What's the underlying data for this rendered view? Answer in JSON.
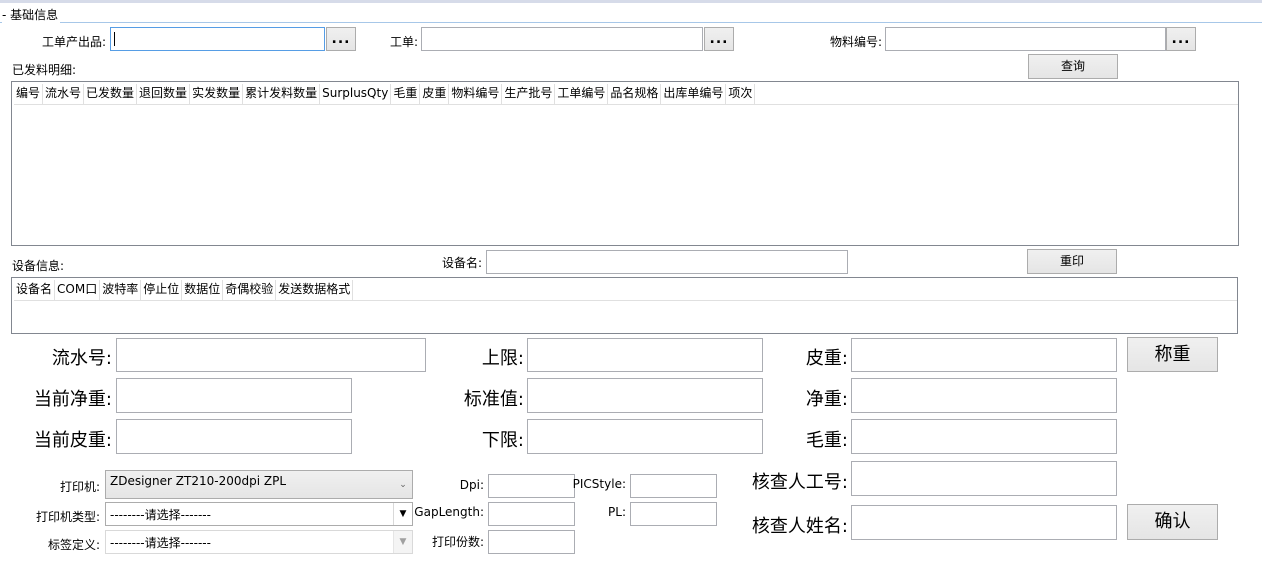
{
  "section": {
    "title": "- 基础信息"
  },
  "top": {
    "product_label": "工单产出品:",
    "product_value": "",
    "workorder_label": "工单:",
    "workorder_value": "",
    "material_label": "物料编号:",
    "material_value": "",
    "ellipsis": "...",
    "query_button": "查询"
  },
  "issued": {
    "label": "已发料明细:",
    "columns": [
      "编号",
      "流水号",
      "已发数量",
      "退回数量",
      "实发数量",
      "累计发料数量",
      "SurplusQty",
      "毛重",
      "皮重",
      "物料编号",
      "生产批号",
      "工单编号",
      "品名规格",
      "出库单编号",
      "项次"
    ]
  },
  "device": {
    "label": "设备信息:",
    "name_label": "设备名:",
    "name_value": "",
    "reprint_button": "重印",
    "columns": [
      "设备名",
      "COM口",
      "波特率",
      "停止位",
      "数据位",
      "奇偶校验",
      "发送数据格式"
    ]
  },
  "weigh": {
    "serial_label": "流水号:",
    "net_current_label": "当前净重:",
    "tare_current_label": "当前皮重:",
    "upper_label": "上限:",
    "standard_label": "标准值:",
    "lower_label": "下限:",
    "tare_label": "皮重:",
    "net_label": "净重:",
    "gross_label": "毛重:",
    "weigh_button": "称重",
    "checker_id_label": "核查人工号:",
    "checker_name_label": "核查人姓名:",
    "confirm_button": "确认"
  },
  "print": {
    "printer_label": "打印机:",
    "printer_value": "ZDesigner ZT210-200dpi ZPL",
    "printer_type_label": "打印机类型:",
    "printer_type_value": "--------请选择-------",
    "label_def_label": "标签定义:",
    "label_def_value": "--------请选择-------",
    "dpi_label": "Dpi:",
    "gaplength_label": "GapLength:",
    "copies_label": "打印份数:",
    "picstyle_label": "PICStyle:",
    "pl_label": "PL:"
  },
  "icons": {
    "dropdown": "chevron-down-icon"
  }
}
